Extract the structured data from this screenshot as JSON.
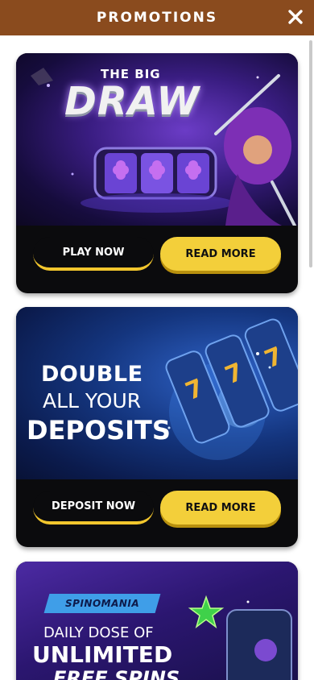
{
  "header": {
    "title": "PROMOTIONS",
    "close_icon": "close-icon"
  },
  "colors": {
    "header_bg": "#8a4b1e",
    "gold": "#f3cf3a",
    "card_bg": "#0b0b0d"
  },
  "promotions": [
    {
      "art": {
        "line1": "THE BIG",
        "line2": "DRAW"
      },
      "primary_label": "PLAY NOW",
      "secondary_label": "READ MORE"
    },
    {
      "art": {
        "line1": "DOUBLE",
        "line2": "ALL YOUR",
        "line3": "DEPOSITS"
      },
      "primary_label": "DEPOSIT NOW",
      "secondary_label": "READ MORE"
    },
    {
      "art": {
        "badge": "SPINOMANIA",
        "line1": "DAILY DOSE OF",
        "line2": "UNLIMITED",
        "line3": "FREE SPINS"
      }
    }
  ]
}
